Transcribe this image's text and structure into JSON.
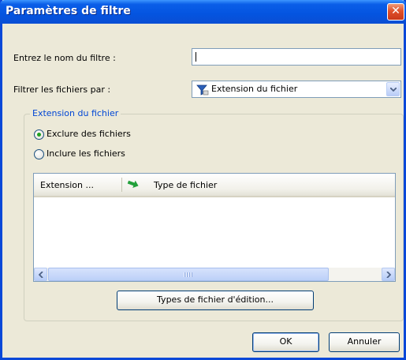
{
  "window": {
    "title": "Paramètres de filtre",
    "close_label": "✕"
  },
  "form": {
    "name_label": "Entrez le nom du filtre :",
    "name_value": "",
    "filter_by_label": "Filtrer les fichiers par :",
    "filter_by_selected": "Extension du fichier",
    "filter_by_icon": "funnel-icon"
  },
  "extension_group": {
    "legend": "Extension du fichier",
    "exclude_label": "Exclure des fichiers",
    "exclude_checked": true,
    "include_label": "Inclure les fichiers",
    "include_checked": false,
    "columns": [
      "Extension ...",
      "Type de fichier"
    ],
    "rows": [],
    "edit_button": "Types de fichier d'édition..."
  },
  "footer": {
    "ok_label": "OK",
    "cancel_label": "Annuler"
  },
  "colors": {
    "titlebar": "#0454e0",
    "group_legend": "#0046d5",
    "window_bg": "#ece9d8"
  }
}
